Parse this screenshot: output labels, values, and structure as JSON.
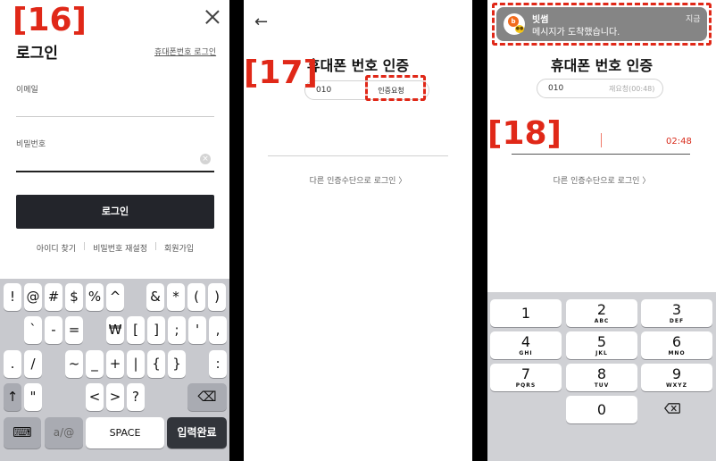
{
  "step_labels": {
    "s16": "[16]",
    "s17": "[17]",
    "s18": "[18]"
  },
  "login_screen": {
    "title": "로그인",
    "phone_login_link": "휴대폰번호 로그인",
    "email_label": "이메일",
    "password_label": "비밀번호",
    "login_button": "로그인",
    "links": [
      "아이디 찾기",
      "비밀번호 재설정",
      "회원가입"
    ],
    "link_separator": "|"
  },
  "symbol_keyboard": {
    "row1": [
      "!",
      "@",
      "#",
      "$",
      "%",
      "^",
      "&",
      "*",
      "(",
      ")"
    ],
    "row2": [
      "`",
      "-",
      "=",
      "₩",
      "[",
      "]",
      ";",
      "'",
      ","
    ],
    "row3": [
      ".",
      "/",
      "~",
      "_",
      "+",
      "|",
      "{",
      "}",
      ":"
    ],
    "row4": [
      "\"",
      "<",
      ">",
      "?"
    ],
    "shift": "↑",
    "backspace": "⌫",
    "keyboard_switch": "⌨",
    "mode_key": "a/@",
    "space_label": "SPACE",
    "done_label": "입력완료"
  },
  "verify_screen": {
    "back_icon": "←",
    "title": "휴대폰 번호 인증",
    "phone_prefix": "010",
    "request_button": "인증요청",
    "other_method_link": "다른 인증수단으로 로그인 〉"
  },
  "code_screen": {
    "notification": {
      "app_name": "빗썸",
      "message": "메시지가 도착했습니다.",
      "time": "지금",
      "icon_text": "b",
      "icon_sub": "●●"
    },
    "title": "휴대폰 번호 인증",
    "phone_prefix": "010",
    "retry_label": "재요청(00:48)",
    "timer": "02:48",
    "other_method_link": "다른 인증수단으로 로그인 〉",
    "numpad": [
      {
        "num": "1",
        "sub": ""
      },
      {
        "num": "2",
        "sub": "ABC"
      },
      {
        "num": "3",
        "sub": "DEF"
      },
      {
        "num": "4",
        "sub": "GHI"
      },
      {
        "num": "5",
        "sub": "JKL"
      },
      {
        "num": "6",
        "sub": "MNO"
      },
      {
        "num": "7",
        "sub": "PQRS"
      },
      {
        "num": "8",
        "sub": "TUV"
      },
      {
        "num": "9",
        "sub": "WXYZ"
      },
      {
        "num": "0",
        "sub": ""
      }
    ]
  }
}
